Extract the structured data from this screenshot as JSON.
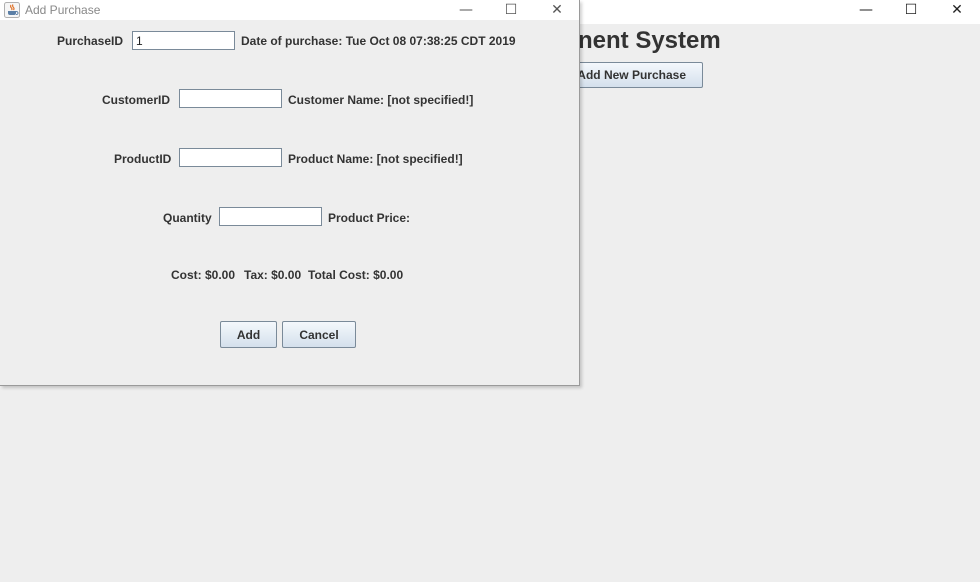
{
  "main_window": {
    "title_partial": "nent System",
    "add_new_purchase_label": "Add New Purchase",
    "controls": {
      "minimize": "—",
      "maximize": "☐",
      "close": "✕"
    }
  },
  "dialog": {
    "title": "Add Purchase",
    "controls": {
      "minimize": "—",
      "maximize": "☐",
      "close": "✕"
    },
    "purchase_id_label": "PurchaseID",
    "purchase_id_value": "1",
    "date_of_purchase": "Date of purchase: Tue Oct 08 07:38:25 CDT 2019",
    "customer_id_label": "CustomerID",
    "customer_id_value": "",
    "customer_name": "Customer Name: [not specified!]",
    "product_id_label": "ProductID",
    "product_id_value": "",
    "product_name": "Product Name: [not specified!]",
    "quantity_label": "Quantity",
    "quantity_value": "",
    "product_price": "Product Price:",
    "cost": "Cost: $0.00",
    "tax": "Tax: $0.00",
    "total_cost": "Total Cost: $0.00",
    "add_label": "Add",
    "cancel_label": "Cancel"
  }
}
